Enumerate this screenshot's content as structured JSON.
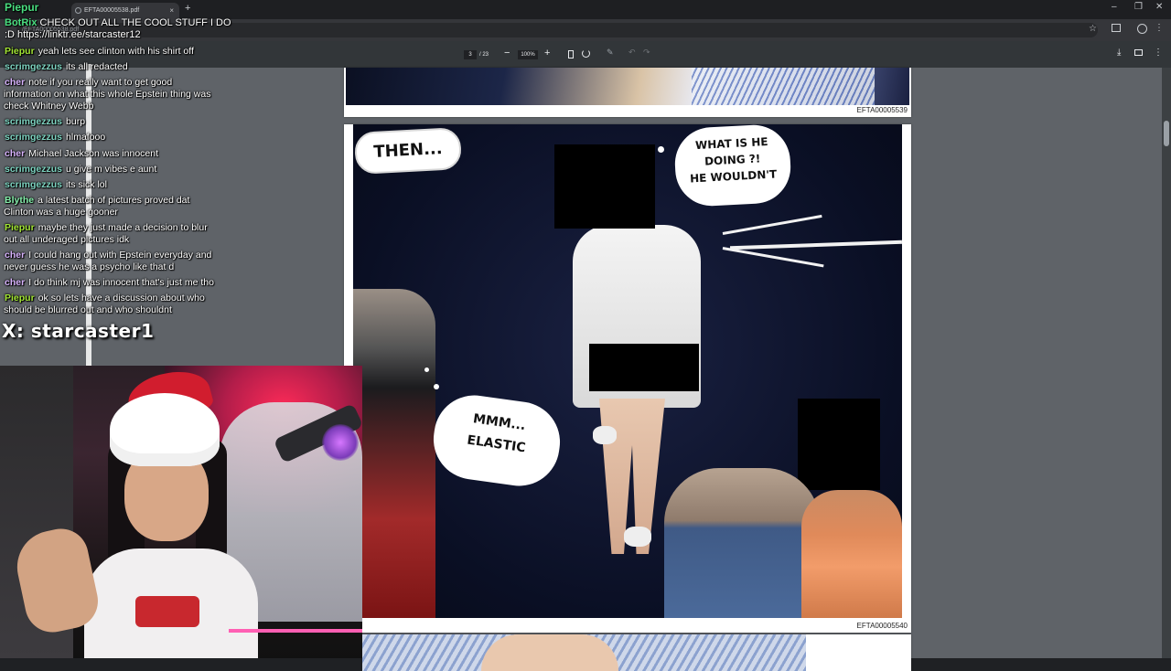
{
  "browser": {
    "tab_title": "EFTA00005538.pdf",
    "url_partial": "/EFTA00005538.pdf"
  },
  "pdf_toolbar": {
    "page_current": "3",
    "page_total": "/ 23",
    "zoom": "100%"
  },
  "pdf_pages": [
    {
      "id": "EFTA00005539"
    },
    {
      "id": "EFTA00005540",
      "bubbles": [
        "THEN...",
        "WHAT IS HE DOING ?!",
        "HE WOULDN'T",
        "MMM...",
        "ELASTIC"
      ]
    }
  ],
  "chat": {
    "first": {
      "user": "Piepur",
      "color": "#4ade80"
    },
    "bot": {
      "user": "BotRix",
      "message": "CHECK OUT ALL THE COOL STUFF I DO",
      "link_line": ":D https://linktr.ee/starcaster12"
    },
    "lines": [
      {
        "user": "Piepur",
        "color": "#a3e635",
        "message": "yeah lets see clinton with his shirt off"
      },
      {
        "user": "scrimgezzus",
        "color": "#7dd3c0",
        "message": "its all redacted"
      },
      {
        "user": "cher",
        "color": "#d8b4fe",
        "message": "note if you really want to get good",
        "message2": "information on what this whole Epstein thing was",
        "message3": "check Whitney Webb"
      },
      {
        "user": "scrimgezzus",
        "color": "#7dd3c0",
        "message": "burp"
      },
      {
        "user": "scrimgezzus",
        "color": "#7dd3c0",
        "message": "hlmafooo"
      },
      {
        "user": "cher",
        "color": "#d8b4fe",
        "message": "Michael Jackson was innocent"
      },
      {
        "user": "scrimgezzus",
        "color": "#7dd3c0",
        "message": "u give m vibes e aunt"
      },
      {
        "user": "scrimgezzus",
        "color": "#7dd3c0",
        "message": "its sick lol"
      },
      {
        "user": "Blythe",
        "color": "#86efac",
        "message": "a latest batch of pictures proved dat",
        "message2": "Clinton was a huge gooner"
      },
      {
        "user": "Piepur",
        "color": "#a3e635",
        "message": "maybe they just made a decision to blur",
        "message2": "out all underaged pictures idk"
      },
      {
        "user": "cher",
        "color": "#d8b4fe",
        "message": "I could hang out with Epstein everyday and",
        "message2": "never guess he was a psycho like that d"
      },
      {
        "user": "cher",
        "color": "#d8b4fe",
        "message": "I do think mj was innocent that's just me tho"
      },
      {
        "user": "Piepur",
        "color": "#a3e635",
        "message": "ok so lets have a discussion about who",
        "message2": "should be blurred out and who shouldnt"
      }
    ]
  },
  "promo": "X: starcaster1",
  "icons": [
    "tab-icon",
    "close-icon",
    "plus-icon",
    "minimize-icon",
    "restore-icon",
    "star-icon",
    "extension-icon",
    "profile-icon",
    "menu-icon",
    "zoom-out-icon",
    "zoom-in-icon",
    "fit-page-icon",
    "rotate-icon",
    "annotate-icon",
    "undo-icon",
    "redo-icon",
    "download-icon",
    "print-icon",
    "more-icon"
  ]
}
